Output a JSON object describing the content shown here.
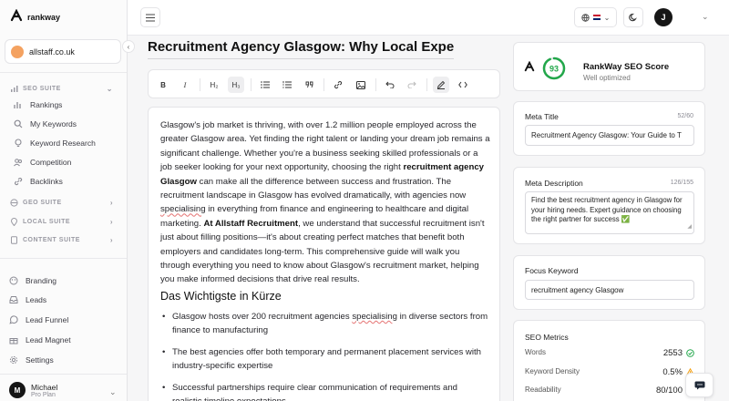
{
  "brand": {
    "logo_mark": "Ꞓ",
    "name": "rankway"
  },
  "workspace": {
    "name": "allstaff.co.uk"
  },
  "sidebar": {
    "seo_suite": "SEO SUITE",
    "seo_items": [
      "Rankings",
      "My Keywords",
      "Keyword Research",
      "Competition",
      "Backlinks"
    ],
    "geo_suite": "GEO SUITE",
    "local_suite": "LOCAL SUITE",
    "content_suite": "CONTENT SUITE",
    "tools": [
      "Branding",
      "Leads",
      "Lead Funnel",
      "Lead Magnet",
      "Settings"
    ]
  },
  "user": {
    "initial": "M",
    "name": "Michael",
    "plan": "Pro Plan"
  },
  "header": {
    "avatar_initial": "J"
  },
  "editor": {
    "title": "Recruitment Agency Glasgow: Why Local Expertise",
    "toolbar": {
      "bold": "B",
      "italic": "I",
      "h2": "H₂",
      "h3": "H₃"
    },
    "p1": "Glasgow's job market is thriving, with over 1.2 million people employed across the greater Glasgow area. Yet finding the right talent or landing your dream job remains a significant challenge. Whether you're a business seeking skilled professionals or a job seeker looking for your next opportunity, choosing the right ",
    "p1_bold": "recruitment agency Glasgow",
    "p1b": " can make all the difference between success and frustration. The recruitment landscape in Glasgow has evolved dramatically, with agencies now ",
    "p1_underline": "specialising",
    "p1c": " in everything from finance and engineering to healthcare and digital marketing. ",
    "p1_bold2": "At Allstaff Recruitment",
    "p1d": ", we understand that successful recruitment isn't just about filling positions—it's about creating perfect matches that benefit both employers and candidates long-term. This comprehensive guide will walk you through everything you need to know about Glasgow's recruitment market, helping you make informed decisions that drive real results.",
    "heading": "Das Wichtigste in Kürze",
    "b1a": "Glasgow hosts over 200 recruitment agencies ",
    "b1_underline": "specialising",
    "b1b": " in diverse sectors from finance to manufacturing",
    "b2": "The best agencies offer both temporary and permanent placement services with industry-specific expertise",
    "b3": "Successful partnerships require clear communication of requirements and realistic timeline expectations"
  },
  "seo_score": {
    "value": "93",
    "score_fraction": 0.93,
    "title": "RankWay SEO Score",
    "subtitle": "Well optimized",
    "color": "#22a74a"
  },
  "meta_title": {
    "label": "Meta Title",
    "count": "52/60",
    "value": "Recruitment Agency Glasgow: Your Guide to T"
  },
  "meta_description": {
    "label": "Meta Description",
    "count": "126/155",
    "value": "Find the best recruitment agency in Glasgow for your hiring needs. Expert guidance on choosing the right partner for success ✅"
  },
  "focus_keyword": {
    "label": "Focus Keyword",
    "value": "recruitment agency Glasgow"
  },
  "metrics": {
    "title": "SEO Metrics",
    "rows": [
      {
        "label": "Words",
        "value": "2553",
        "status": "ok"
      },
      {
        "label": "Keyword Density",
        "value": "0.5%",
        "status": "warn"
      },
      {
        "label": "Readability",
        "value": "80/100",
        "status": "ok"
      }
    ]
  }
}
